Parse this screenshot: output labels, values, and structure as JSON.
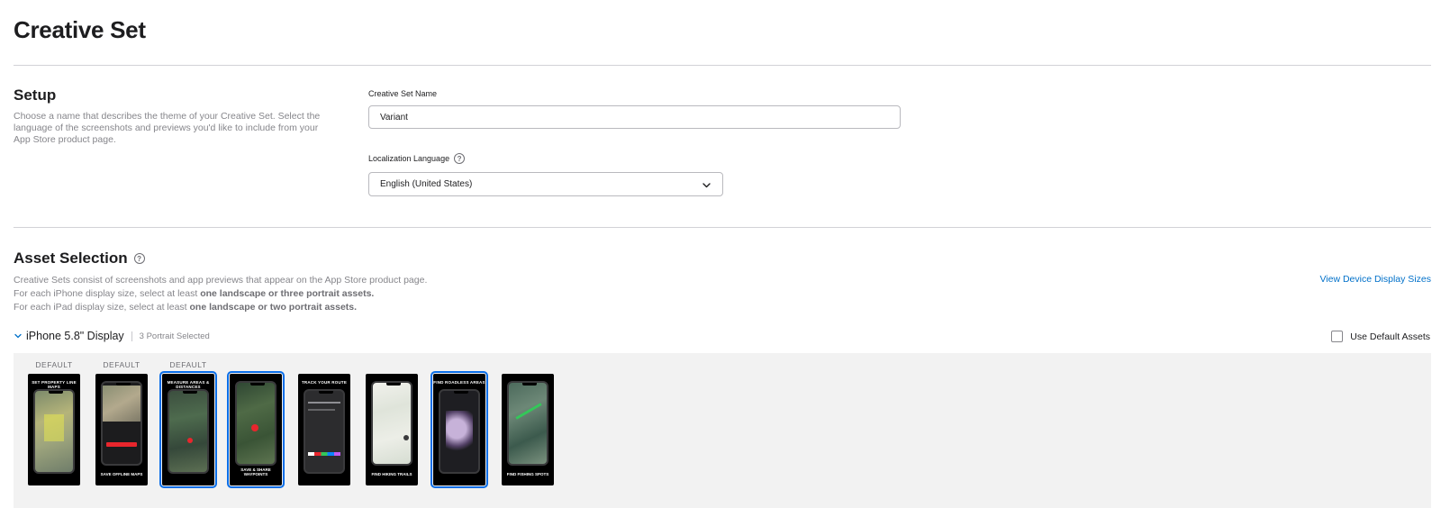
{
  "page": {
    "title": "Creative Set"
  },
  "setup": {
    "title": "Setup",
    "description_lines": [
      "Choose a name that describes the theme of your Creative Set. Select the",
      "language of the screenshots and previews you'd like to include from your",
      "App Store product page."
    ],
    "name_label": "Creative Set Name",
    "name_value": "Variant",
    "language_label": "Localization Language",
    "language_value": "English (United States)"
  },
  "asset_selection": {
    "title": "Asset Selection",
    "line1": "Creative Sets consist of screenshots and app previews that appear on the App Store product page.",
    "line2_prefix": "For each iPhone display size, select at least ",
    "line2_bold": "one landscape or three portrait assets.",
    "line3_prefix": "For each iPad display size, select at least ",
    "line3_bold": "one landscape or two portrait assets.",
    "view_sizes_link": "View Device Display Sizes"
  },
  "device_group": {
    "name": "iPhone 5.8\" Display",
    "selected_count": "3 Portrait Selected",
    "use_default_label": "Use Default Assets",
    "use_default_checked": false,
    "default_label": "DEFAULT",
    "thumbnails": [
      {
        "top": "SET PROPERTY LINE MAPS",
        "bottom": "",
        "default": true,
        "selected": false,
        "screen": "yellow-map"
      },
      {
        "top": "",
        "bottom": "SAVE OFFLINE MAPS",
        "default": true,
        "selected": false,
        "screen": "terrain-dialog"
      },
      {
        "top": "MEASURE AREAS & DISTANCES",
        "bottom": "",
        "default": true,
        "selected": true,
        "screen": "dark-terrain"
      },
      {
        "top": "",
        "bottom": "SAVE & SHARE WAYPOINTS",
        "default": false,
        "selected": true,
        "screen": "green-terrain"
      },
      {
        "top": "TRACK YOUR ROUTE",
        "bottom": "",
        "default": false,
        "selected": false,
        "screen": "route-ui"
      },
      {
        "top": "",
        "bottom": "FIND HIKING TRAILS",
        "default": false,
        "selected": false,
        "screen": "topo-light"
      },
      {
        "top": "FIND ROADLESS AREAS",
        "bottom": "",
        "default": false,
        "selected": true,
        "screen": "purple-areas"
      },
      {
        "top": "",
        "bottom": "FIND FISHING SPOTS",
        "default": false,
        "selected": false,
        "screen": "satellite-water"
      }
    ]
  },
  "colors": {
    "accent": "#0070c9",
    "selection": "#0a6ee8",
    "highlight_red": "#e8262d"
  }
}
